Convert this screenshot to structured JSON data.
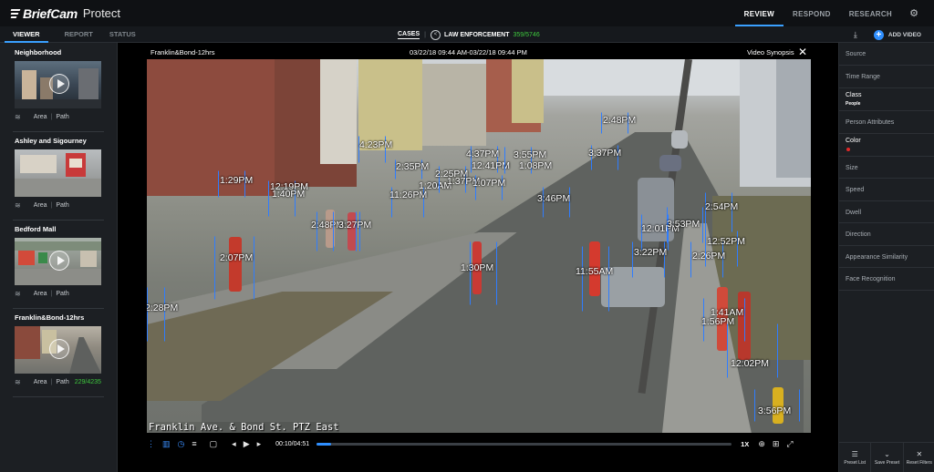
{
  "app": {
    "brand": "BriefCam",
    "product": "Protect"
  },
  "topnav": {
    "review": "REVIEW",
    "respond": "RESPOND",
    "research": "RESEARCH",
    "settings_icon": "gear-icon"
  },
  "subnav": {
    "viewer": "VIEWER",
    "report": "REPORT",
    "status": "STATUS"
  },
  "cases": {
    "label": "CASES",
    "law_enforcement": "LAW ENFORCEMENT",
    "count": "359/5746"
  },
  "actions": {
    "add_video": "ADD VIDEO"
  },
  "videos": [
    {
      "title": "Neighborhood",
      "area": "Area",
      "path": "Path",
      "count": ""
    },
    {
      "title": "Ashley and Sigourney",
      "area": "Area",
      "path": "Path",
      "count": ""
    },
    {
      "title": "Bedford Mall",
      "area": "Area",
      "path": "Path",
      "count": ""
    },
    {
      "title": "Franklin&Bond-12hrs",
      "area": "Area",
      "path": "Path",
      "count": "229/4235"
    }
  ],
  "player": {
    "video_name": "Franklin&Bond-12hrs",
    "range": "03/22/18 09:44 AM-03/22/18 09:44 PM",
    "mode": "Video Synopsis",
    "caption": "Franklin Ave. & Bond St. PTZ East",
    "time": "00:10/04:51",
    "progress": 0.035,
    "speed": "1X"
  },
  "detections": [
    "1:29PM",
    "12:19PM",
    "1:40PM",
    "4:23PM",
    "2:35PM",
    "11:26PM",
    "1:20AM",
    "2:25PM",
    "1:37PM",
    "4:37PM",
    "12:41PM",
    "3:55PM",
    "1:08PM",
    "1:07PM",
    "2:48PM",
    "3:37PM",
    "3:46PM",
    "2:48PM",
    "3:27PM",
    "2:07PM",
    "1:30PM",
    "11:55AM",
    "12:01PM",
    "3:53PM",
    "2:54PM",
    "3:22PM",
    "2:26PM",
    "12:52PM",
    "1:41AM",
    "1:56PM",
    "12:02PM",
    "3:56PM",
    "2:28PM"
  ],
  "filters": {
    "source": "Source",
    "time_range": "Time Range",
    "class": "Class",
    "class_value": "People",
    "person_attributes": "Person Attributes",
    "color": "Color",
    "color_value": "#e02828",
    "size": "Size",
    "speed": "Speed",
    "dwell": "Dwell",
    "direction": "Direction",
    "appearance_similarity": "Appearance Similarity",
    "face_recognition": "Face Recognition"
  },
  "filter_actions": {
    "preset_list": "Preset List",
    "save_preset": "Save Preset",
    "reset_filters": "Reset Filters"
  }
}
